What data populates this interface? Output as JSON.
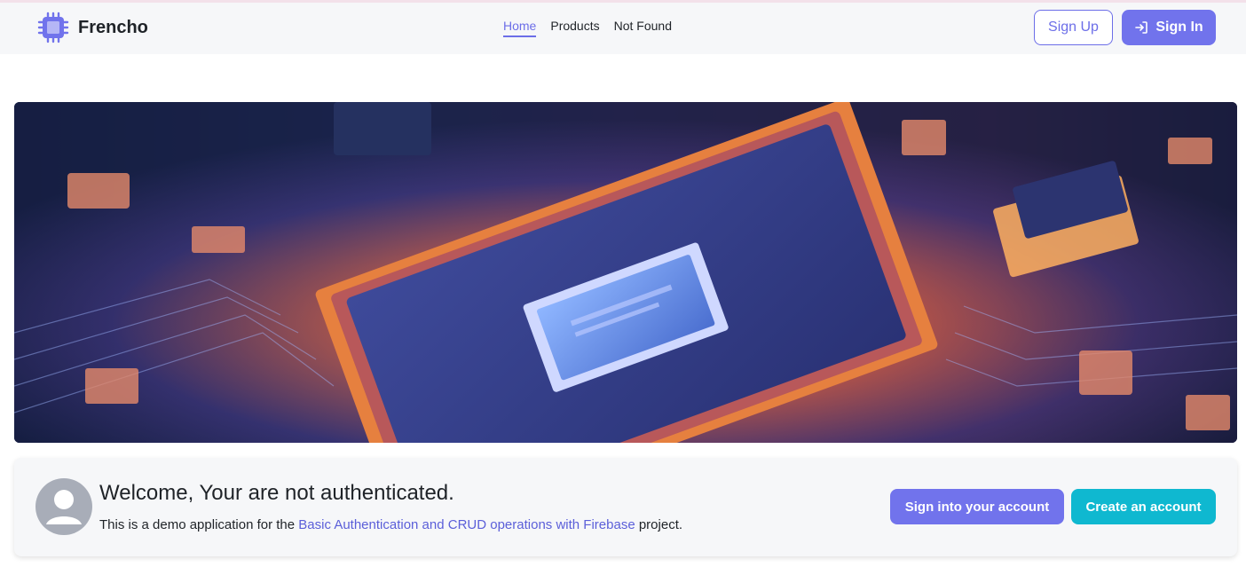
{
  "navbar": {
    "brand_name": "Frencho",
    "brand_icon": "cpu-chip-icon",
    "links": [
      {
        "label": "Home",
        "active": true
      },
      {
        "label": "Products",
        "active": false
      },
      {
        "label": "Not Found",
        "active": false
      }
    ],
    "sign_up_label": "Sign Up",
    "sign_in_label": "Sign In",
    "sign_in_icon": "login-icon"
  },
  "hero": {
    "image": "circuit-board-processor-image"
  },
  "welcome": {
    "avatar_icon": "user-avatar-icon",
    "title": "Welcome, Your are not authenticated.",
    "text_before": "This is a demo application for the ",
    "link_text": "Basic Authentication and CRUD operations with Firebase",
    "text_after": " project.",
    "sign_into_label": "Sign into your account",
    "create_label": "Create an account"
  },
  "colors": {
    "primary": "#7173ec",
    "accent": "#0fb8d0",
    "navbar_bg": "#f6f7f9"
  }
}
